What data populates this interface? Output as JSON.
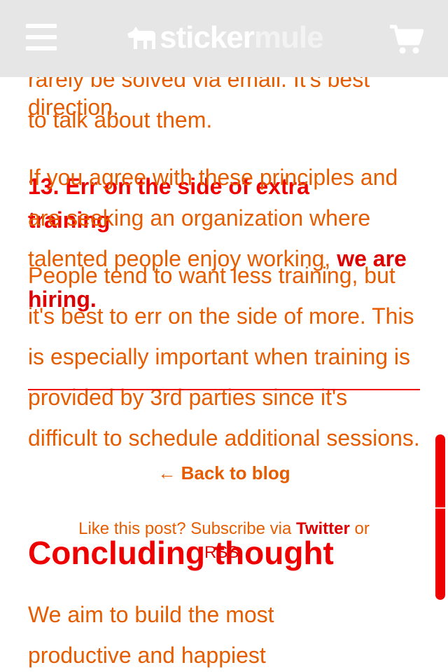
{
  "header": {
    "logo_part1": "sticker",
    "logo_part2": "mule"
  },
  "layer_a": {
    "line1": "rarely be solved via email. It's best",
    "line2": "to talk about them.",
    "heading_line1": "13. Err on the side of extra",
    "heading_line2": "training",
    "para": "People tend to want less training, but it's best to err on the side of more. This is especially important when training is provided by 3rd parties since it's difficult to schedule additional sessions.",
    "concluding_heading": "Concluding thought",
    "concluding_line1": "We aim to build the most",
    "concluding_line2": "productive and happiest"
  },
  "layer_b": {
    "line1": "direction.",
    "para": "If you agree with these principles and are seeking an organization where talented people enjoy working, ",
    "hiring_link": "we are hiring.",
    "back_link": "← Back to blog",
    "subscribe_text": "Like this post? Subscribe via ",
    "twitter": "Twitter",
    "or": " or",
    "rss": "RSS."
  }
}
